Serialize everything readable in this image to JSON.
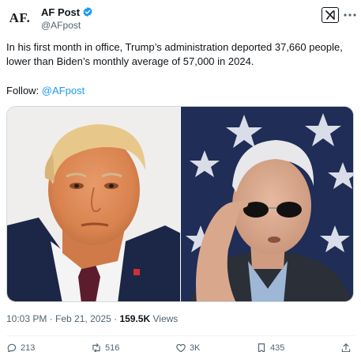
{
  "author": {
    "avatar_text": "AF.",
    "display_name": "AF Post",
    "handle": "@AFpost"
  },
  "tweet": {
    "text": "In his first month in office, Trump’s administration deported 37,660 people, lower than Biden’s monthly average of 57,000 in 2024.",
    "follow_prefix": "Follow: ",
    "follow_handle": "@AFpost"
  },
  "media": {
    "photos": [
      {
        "name": "trump-photo"
      },
      {
        "name": "biden-photo"
      }
    ]
  },
  "meta": {
    "time": "10:03 PM",
    "separator": " · ",
    "date": "Feb 21, 2025",
    "separator2": " · ",
    "views_count": "159.5K",
    "views_label": " Views"
  },
  "actions": {
    "replies": "213",
    "reposts": "516",
    "likes": "3K",
    "bookmarks": "435"
  },
  "colors": {
    "accent": "#1d9bf0",
    "secondary_text": "#536471",
    "primary_text": "#0f1419"
  }
}
